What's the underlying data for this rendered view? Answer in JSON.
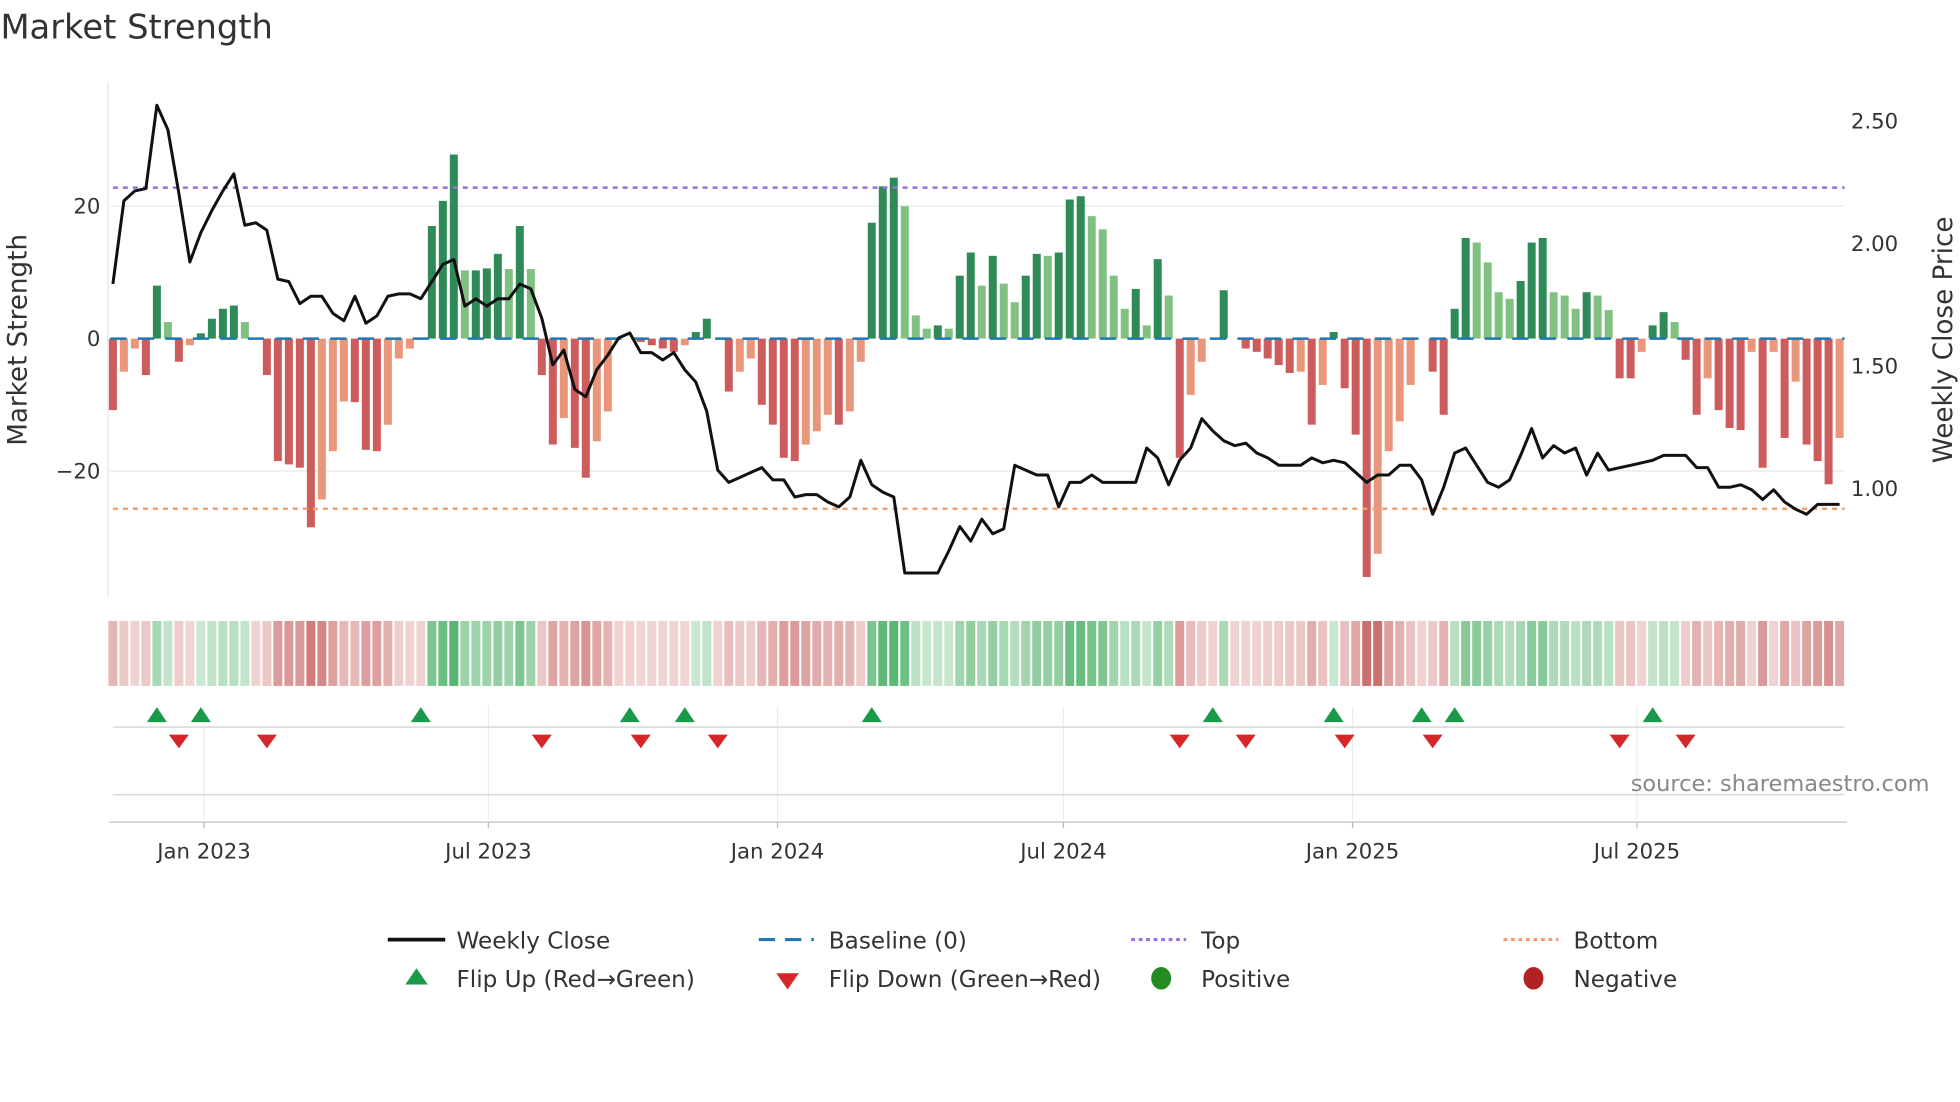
{
  "title": "Market Strength",
  "source": "source: sharemaestro.com",
  "colors": {
    "close_line": "#111111",
    "baseline": "#1f77b4",
    "top": "#9b6fd6",
    "bottom": "#f0a070",
    "strong_positive": "#2e8b57",
    "weak_positive": "#80c080",
    "strong_negative": "#cd5c5c",
    "weak_negative": "#e9967a",
    "flip_up": "#1a9a48",
    "flip_down": "#d62728",
    "positive": "#228b22",
    "negative": "#b22222"
  },
  "legend": [
    {
      "label": "Weekly Close",
      "symbol": "solid-line"
    },
    {
      "label": "Baseline (0)",
      "symbol": "dashed-line"
    },
    {
      "label": "Top",
      "symbol": "dotted-line"
    },
    {
      "label": "Bottom",
      "symbol": "dotted-line"
    },
    {
      "label": "Flip Up (Red→Green)",
      "symbol": "triangle-up"
    },
    {
      "label": "Flip Down (Green→Red)",
      "symbol": "triangle-down"
    },
    {
      "label": "Positive",
      "symbol": "circle"
    },
    {
      "label": "Negative",
      "symbol": "circle"
    }
  ],
  "chart_data": {
    "type": "bar",
    "title": "Market Strength",
    "ylabel": "Market Strength",
    "y2label": "Weekly Close Price",
    "xticks": [
      "Jan 2023",
      "Jul 2023",
      "Jan 2024",
      "Jul 2024",
      "Jan 2025",
      "Jul 2025"
    ],
    "xtick_dates": [
      "2023-01-01",
      "2023-07-01",
      "2024-01-01",
      "2024-07-01",
      "2025-01-01",
      "2025-07-01"
    ],
    "yticks": [
      "20",
      "0",
      "−20"
    ],
    "ytick_values": [
      20,
      0,
      -20
    ],
    "y2ticks": [
      "2.50",
      "2.00",
      "1.50",
      "1.00"
    ],
    "y2tick_values": [
      2.5,
      2.0,
      1.5,
      1.0
    ],
    "grid": true,
    "legend_position": "bottom",
    "top_level": 22.8,
    "bottom_level": -25.7,
    "baseline": 0,
    "dates": [
      "2022-11-04",
      "2022-11-11",
      "2022-11-18",
      "2022-11-25",
      "2022-12-02",
      "2022-12-09",
      "2022-12-16",
      "2022-12-23",
      "2022-12-30",
      "2023-01-06",
      "2023-01-13",
      "2023-01-20",
      "2023-01-27",
      "2023-02-03",
      "2023-02-10",
      "2023-02-17",
      "2023-02-24",
      "2023-03-03",
      "2023-03-10",
      "2023-03-17",
      "2023-03-24",
      "2023-03-31",
      "2023-04-07",
      "2023-04-14",
      "2023-04-21",
      "2023-04-28",
      "2023-05-05",
      "2023-05-12",
      "2023-05-19",
      "2023-05-26",
      "2023-06-02",
      "2023-06-09",
      "2023-06-16",
      "2023-06-23",
      "2023-06-30",
      "2023-07-07",
      "2023-07-14",
      "2023-07-21",
      "2023-07-28",
      "2023-08-04",
      "2023-08-11",
      "2023-08-18",
      "2023-08-25",
      "2023-09-01",
      "2023-09-08",
      "2023-09-15",
      "2023-09-22",
      "2023-09-29",
      "2023-10-06",
      "2023-10-13",
      "2023-10-20",
      "2023-10-27",
      "2023-11-03",
      "2023-11-10",
      "2023-11-17",
      "2023-11-24",
      "2023-12-01",
      "2023-12-08",
      "2023-12-15",
      "2023-12-22",
      "2023-12-29",
      "2024-01-05",
      "2024-01-12",
      "2024-01-19",
      "2024-01-26",
      "2024-02-02",
      "2024-02-09",
      "2024-02-16",
      "2024-02-23",
      "2024-03-01",
      "2024-03-08",
      "2024-03-15",
      "2024-03-22",
      "2024-03-29",
      "2024-04-05",
      "2024-04-12",
      "2024-04-19",
      "2024-04-26",
      "2024-05-03",
      "2024-05-10",
      "2024-05-17",
      "2024-05-24",
      "2024-05-31",
      "2024-06-07",
      "2024-06-14",
      "2024-06-21",
      "2024-06-28",
      "2024-07-05",
      "2024-07-12",
      "2024-07-19",
      "2024-07-26",
      "2024-08-02",
      "2024-08-09",
      "2024-08-16",
      "2024-08-23",
      "2024-08-30",
      "2024-09-06",
      "2024-09-13",
      "2024-09-20",
      "2024-09-27",
      "2024-10-04",
      "2024-10-11",
      "2024-10-18",
      "2024-10-25",
      "2024-11-01",
      "2024-11-08",
      "2024-11-15",
      "2024-11-22",
      "2024-11-29",
      "2024-12-06",
      "2024-12-13",
      "2024-12-20",
      "2024-12-27",
      "2025-01-03",
      "2025-01-10",
      "2025-01-17",
      "2025-01-24",
      "2025-01-31",
      "2025-02-07",
      "2025-02-14",
      "2025-02-21",
      "2025-02-28",
      "2025-03-07",
      "2025-03-14",
      "2025-03-21",
      "2025-03-28",
      "2025-04-04",
      "2025-04-11",
      "2025-04-18",
      "2025-04-25",
      "2025-05-02",
      "2025-05-09",
      "2025-05-16",
      "2025-05-23",
      "2025-05-30",
      "2025-06-06",
      "2025-06-13",
      "2025-06-20",
      "2025-06-27",
      "2025-07-04",
      "2025-07-11",
      "2025-07-18",
      "2025-07-25",
      "2025-08-01",
      "2025-08-08",
      "2025-08-15",
      "2025-08-22",
      "2025-08-29",
      "2025-09-05",
      "2025-09-12",
      "2025-09-19",
      "2025-09-26",
      "2025-10-03",
      "2025-10-10",
      "2025-10-17",
      "2025-10-24",
      "2025-10-31",
      "2025-11-07"
    ],
    "strength": [
      -10.8,
      -5,
      -1.5,
      -5.5,
      8,
      2.5,
      -3.5,
      -1,
      0.8,
      3,
      4.5,
      5,
      2.5,
      0,
      -5.5,
      -18.5,
      -19,
      -19.5,
      -28.5,
      -24.3,
      -17,
      -9.5,
      -9.6,
      -16.8,
      -17,
      -13,
      -3,
      -1.5,
      0,
      17,
      20.8,
      27.8,
      10.3,
      10.3,
      10.6,
      12.8,
      10.5,
      17,
      10.5,
      -5.5,
      -16,
      -12,
      -16.5,
      -21,
      -15.5,
      -11,
      0,
      0,
      -0.5,
      -1,
      -1.5,
      -2,
      -1,
      1,
      3,
      0,
      -8,
      -5,
      -3,
      -10,
      -13,
      -18,
      -18.5,
      -16,
      -14,
      -11.5,
      -13,
      -11,
      -3.5,
      17.5,
      23,
      24.3,
      20,
      3.5,
      1.5,
      2,
      1.5,
      9.5,
      13,
      8,
      12.5,
      8.3,
      5.5,
      9.5,
      12.8,
      12.5,
      13,
      21,
      21.5,
      18.5,
      16.5,
      9.5,
      4.5,
      7.5,
      2,
      12,
      6.5,
      -18,
      -8.5,
      -3.5,
      0,
      7.3,
      0,
      -1.5,
      -2,
      -3,
      -4,
      -5.2,
      -5,
      -13,
      -7,
      1,
      -7.5,
      -14.5,
      -36,
      -32.5,
      -17,
      -12.5,
      -7,
      0,
      -5,
      -11.5,
      4.5,
      15.2,
      14.5,
      11.5,
      7,
      6,
      8.7,
      14.5,
      15.2,
      7,
      6.5,
      4.5,
      7,
      6.5,
      4.3,
      -6,
      -6,
      -2,
      2,
      4,
      2.5,
      -3.2,
      -11.5,
      -6,
      -10.8,
      -13.5,
      -13.8,
      -2,
      -19.5,
      -2,
      -15,
      -6.5,
      -16,
      -18.5,
      -22,
      -15
    ],
    "weekly_close": [
      1.83,
      2.17,
      2.21,
      2.22,
      2.56,
      2.46,
      2.2,
      1.92,
      2.04,
      2.13,
      2.21,
      2.28,
      2.07,
      2.08,
      2.05,
      1.85,
      1.84,
      1.75,
      1.78,
      1.78,
      1.71,
      1.68,
      1.78,
      1.67,
      1.7,
      1.78,
      1.79,
      1.79,
      1.77,
      1.84,
      1.91,
      1.93,
      1.74,
      1.77,
      1.74,
      1.77,
      1.77,
      1.83,
      1.81,
      1.69,
      1.5,
      1.56,
      1.4,
      1.37,
      1.48,
      1.54,
      1.61,
      1.63,
      1.55,
      1.55,
      1.52,
      1.55,
      1.48,
      1.43,
      1.31,
      1.07,
      1.02,
      1.04,
      1.06,
      1.08,
      1.03,
      1.03,
      0.96,
      0.97,
      0.97,
      0.94,
      0.92,
      0.96,
      1.11,
      1.01,
      0.98,
      0.96,
      0.65,
      0.65,
      0.65,
      0.65,
      0.74,
      0.84,
      0.78,
      0.87,
      0.81,
      0.83,
      1.09,
      1.07,
      1.05,
      1.05,
      0.92,
      1.02,
      1.02,
      1.05,
      1.02,
      1.02,
      1.02,
      1.02,
      1.16,
      1.12,
      1.01,
      1.11,
      1.16,
      1.28,
      1.23,
      1.19,
      1.17,
      1.18,
      1.14,
      1.12,
      1.09,
      1.09,
      1.09,
      1.12,
      1.1,
      1.11,
      1.1,
      1.06,
      1.02,
      1.05,
      1.05,
      1.09,
      1.09,
      1.03,
      0.89,
      1.0,
      1.14,
      1.16,
      1.09,
      1.02,
      1.0,
      1.03,
      1.13,
      1.24,
      1.12,
      1.17,
      1.14,
      1.16,
      1.05,
      1.14,
      1.07,
      1.08,
      1.09,
      1.1,
      1.11,
      1.13,
      1.13,
      1.13,
      1.08,
      1.08,
      1.0,
      1.0,
      1.01,
      0.99,
      0.95,
      0.99,
      0.94,
      0.91,
      0.89,
      0.93,
      0.93,
      0.93
    ],
    "flip_up_dates": [
      "2022-12-02",
      "2022-12-30",
      "2023-05-19",
      "2023-09-29",
      "2023-11-03",
      "2024-03-01",
      "2024-10-04",
      "2024-12-20",
      "2025-02-14",
      "2025-03-07",
      "2025-07-11"
    ],
    "flip_down_dates": [
      "2022-12-16",
      "2023-02-10",
      "2023-08-04",
      "2023-10-06",
      "2023-11-24",
      "2024-09-13",
      "2024-10-25",
      "2024-12-27",
      "2025-02-21",
      "2025-06-20",
      "2025-08-01"
    ]
  }
}
